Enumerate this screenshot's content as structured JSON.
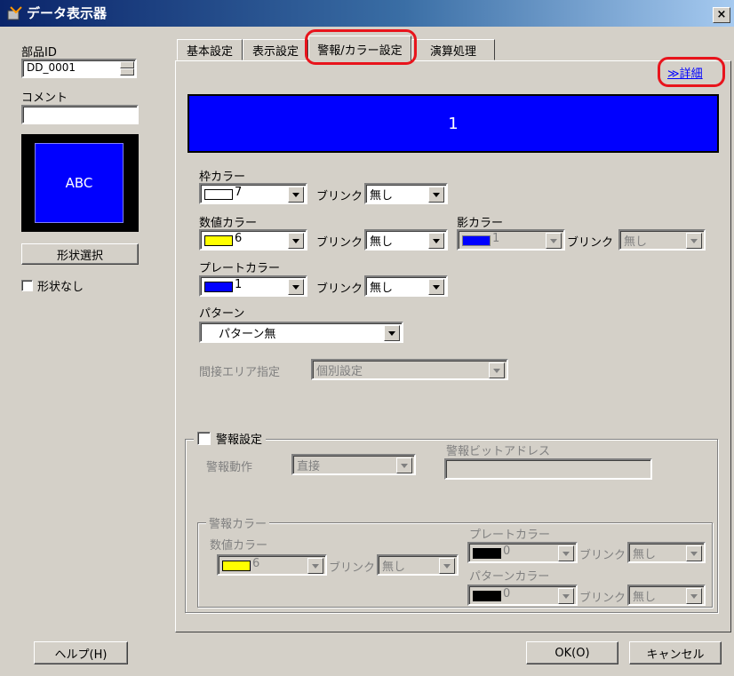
{
  "window": {
    "title": "データ表示器",
    "close_label": "×"
  },
  "left": {
    "part_id_label": "部品ID",
    "part_id_value": "DD_0001",
    "comment_label": "コメント",
    "comment_value": "",
    "preview_text": "ABC",
    "shape_select_label": "形状選択",
    "no_shape_label": "形状なし"
  },
  "tabs": [
    {
      "label": "基本設定"
    },
    {
      "label": "表示設定"
    },
    {
      "label": "警報/カラー設定",
      "active": true
    },
    {
      "label": "演算処理"
    }
  ],
  "panel": {
    "detail_link": "詳細",
    "detail_prefix": "≫",
    "display_value": "1",
    "frame_color": {
      "label": "枠カラー",
      "value": "7",
      "swatch": "#ffffff",
      "blink_label": "ブリンク",
      "blink_value": "無し"
    },
    "number_color": {
      "label": "数値カラー",
      "value": "6",
      "swatch": "#ffff00",
      "blink_label": "ブリンク",
      "blink_value": "無し"
    },
    "shadow_color": {
      "label": "影カラー",
      "value": "1",
      "swatch": "#0000ff",
      "blink_label": "ブリンク",
      "blink_value": "無し"
    },
    "plate_color": {
      "label": "プレートカラー",
      "value": "1",
      "swatch": "#0000ff",
      "blink_label": "ブリンク",
      "blink_value": "無し"
    },
    "pattern": {
      "label": "パターン",
      "value": "パターン無"
    },
    "indirect_area": {
      "label": "間接エリア指定",
      "value": "個別設定"
    },
    "alarm": {
      "checkbox_label": "警報設定",
      "action_label": "警報動作",
      "action_value": "直接",
      "bit_address_label": "警報ビットアドレス",
      "bit_address_value": "",
      "color_group_label": "警報カラー",
      "number_color": {
        "label": "数値カラー",
        "value": "6",
        "swatch": "#ffff00",
        "blink_label": "ブリンク",
        "blink_value": "無し"
      },
      "plate_color": {
        "label": "プレートカラー",
        "value": "0",
        "swatch": "#000000",
        "blink_label": "ブリンク",
        "blink_value": "無し"
      },
      "pattern_color": {
        "label": "パターンカラー",
        "value": "0",
        "swatch": "#000000",
        "blink_label": "ブリンク",
        "blink_value": "無し"
      }
    }
  },
  "footer": {
    "help_label": "ヘルプ(H)",
    "ok_label": "OK(O)",
    "cancel_label": "キャンセル"
  },
  "colors": {
    "display_bg": "#0000ff",
    "title_bar": "#0a246a",
    "highlight": "#e8141c",
    "dialog_bg": "#d4d0c8"
  }
}
